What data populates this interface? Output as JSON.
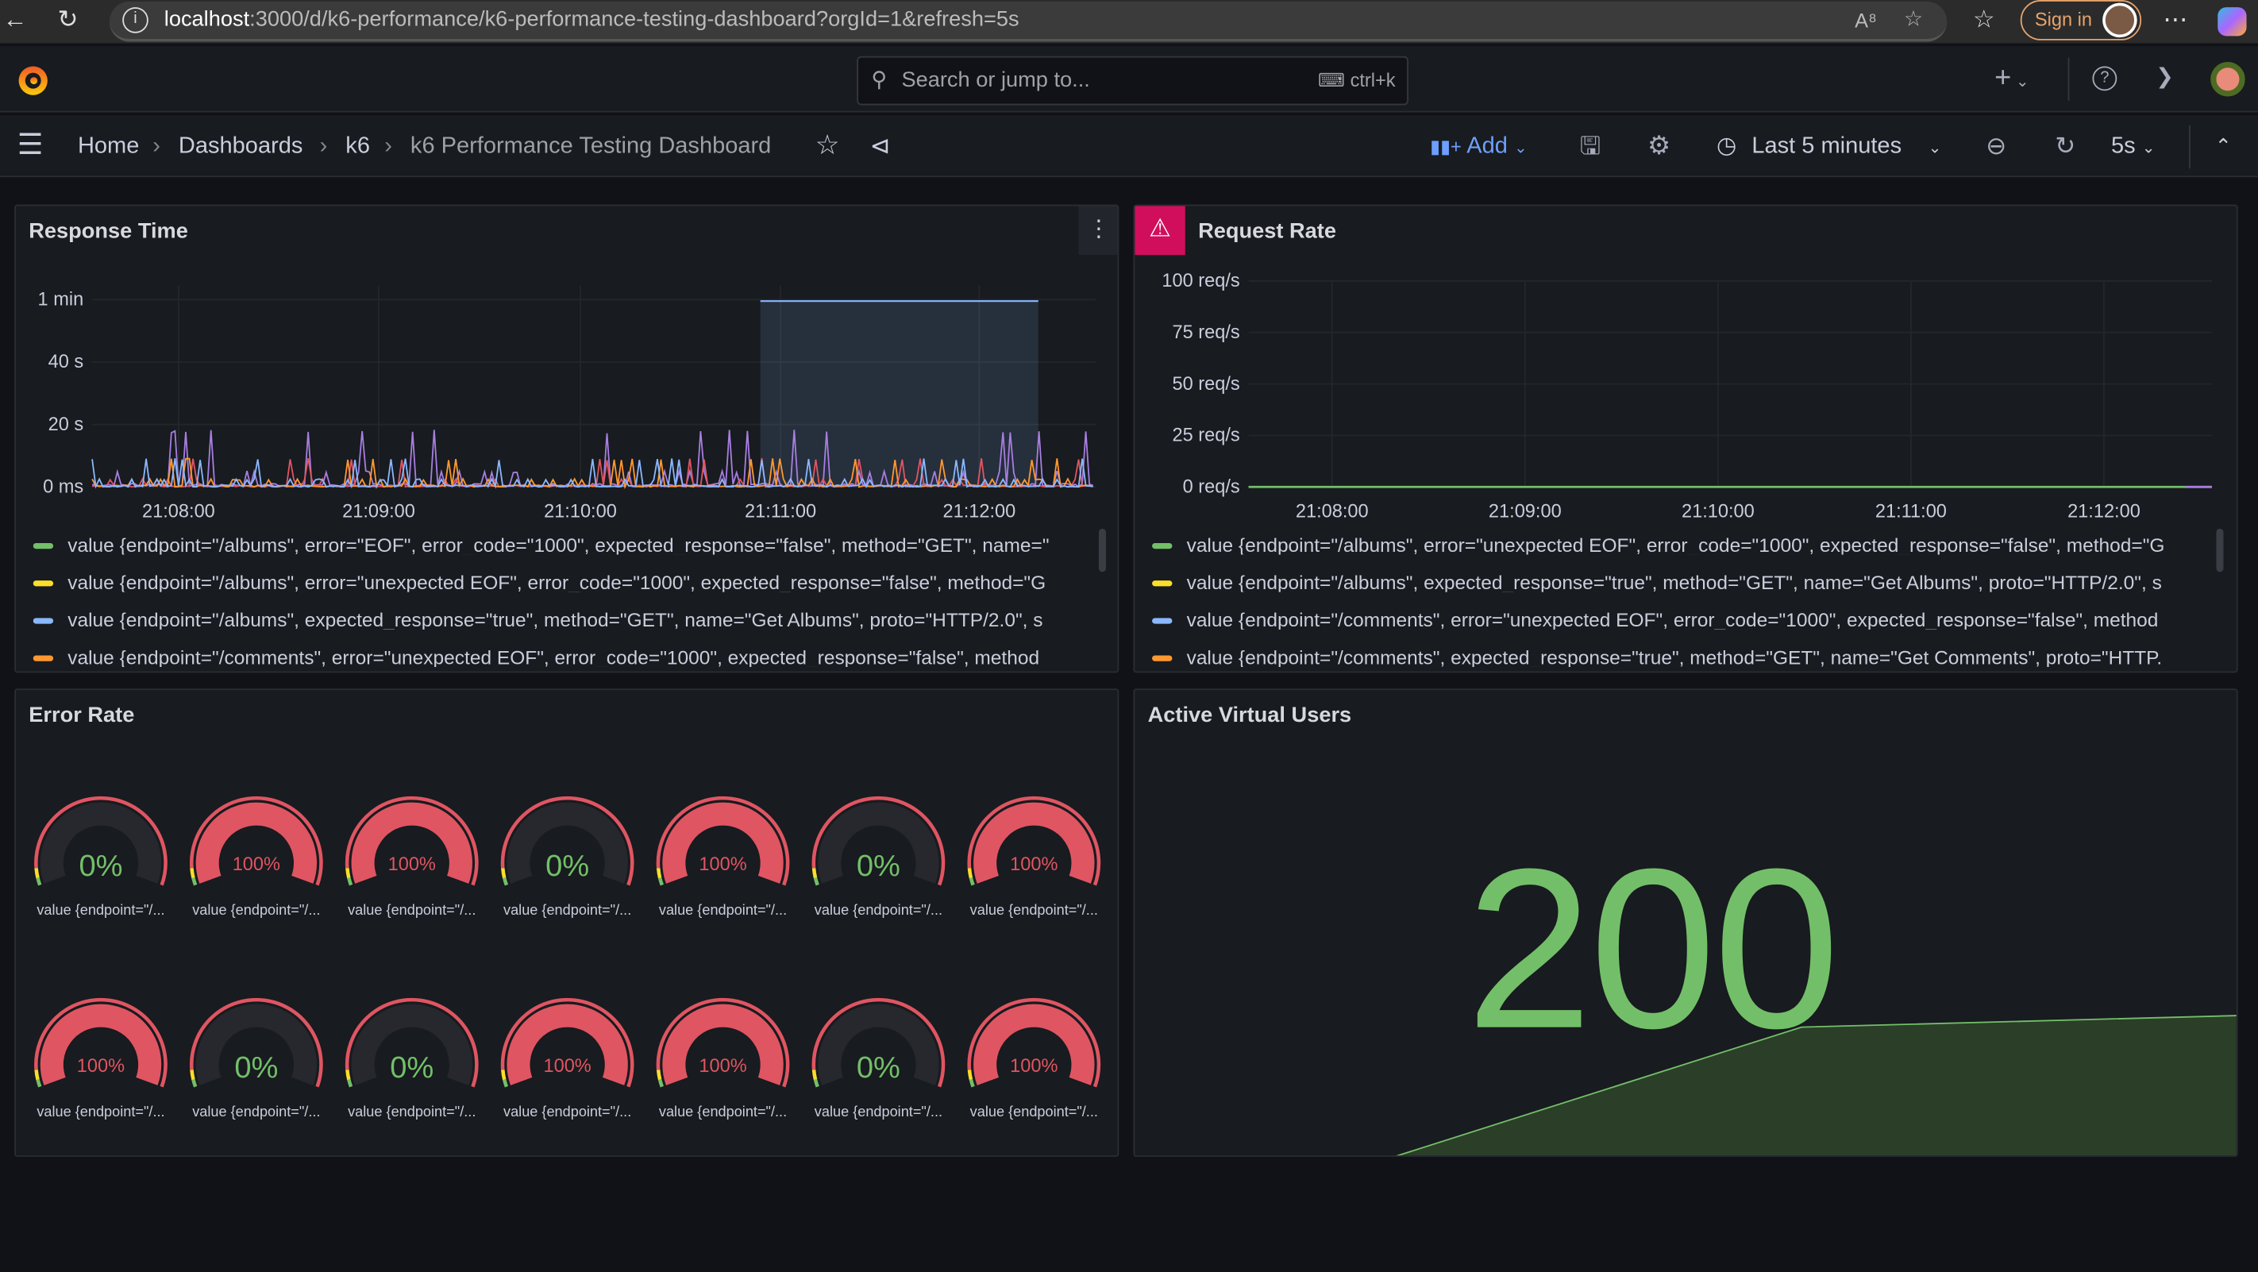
{
  "browser": {
    "url_host": "localhost",
    "url_rest": ":3000/d/k6-performance/k6-performance-testing-dashboard?orgId=1&refresh=5s",
    "sign_in": "Sign in"
  },
  "topnav": {
    "search_placeholder": "Search or jump to...",
    "shortcut": "ctrl+k"
  },
  "breadcrumb": {
    "items": [
      "Home",
      "Dashboards",
      "k6",
      "k6 Performance Testing Dashboard"
    ]
  },
  "toolbar": {
    "add": "Add",
    "time_range": "Last 5 minutes",
    "refresh_interval": "5s"
  },
  "panels": {
    "response_time": {
      "title": "Response Time",
      "legend": [
        {
          "color": "#73bf69",
          "text": "value {endpoint=\"/albums\", error=\"EOF\", error_code=\"1000\", expected_response=\"false\", method=\"GET\", name=\""
        },
        {
          "color": "#fade2a",
          "text": "value {endpoint=\"/albums\", error=\"unexpected EOF\", error_code=\"1000\", expected_response=\"false\", method=\"G"
        },
        {
          "color": "#8ab8ff",
          "text": "value {endpoint=\"/albums\", expected_response=\"true\", method=\"GET\", name=\"Get Albums\", proto=\"HTTP/2.0\", s"
        },
        {
          "color": "#ff9830",
          "text": "value {endpoint=\"/comments\", error=\"unexpected EOF\", error_code=\"1000\", expected_response=\"false\", method"
        }
      ]
    },
    "request_rate": {
      "title": "Request Rate",
      "legend": [
        {
          "color": "#73bf69",
          "text": "value {endpoint=\"/albums\", error=\"unexpected EOF\", error_code=\"1000\", expected_response=\"false\", method=\"G"
        },
        {
          "color": "#fade2a",
          "text": "value {endpoint=\"/albums\", expected_response=\"true\", method=\"GET\", name=\"Get Albums\", proto=\"HTTP/2.0\", s"
        },
        {
          "color": "#8ab8ff",
          "text": "value {endpoint=\"/comments\", error=\"unexpected EOF\", error_code=\"1000\", expected_response=\"false\", method"
        },
        {
          "color": "#ff9830",
          "text": "value {endpoint=\"/comments\", expected_response=\"true\", method=\"GET\", name=\"Get Comments\", proto=\"HTTP."
        }
      ]
    },
    "error_rate": {
      "title": "Error Rate",
      "gauge_label": "value {endpoint=\"/...",
      "values": [
        0,
        100,
        100,
        0,
        100,
        0,
        100,
        100,
        0,
        0,
        100,
        100,
        0,
        100
      ],
      "unit": "%"
    },
    "active_vus": {
      "title": "Active Virtual Users",
      "value": "200"
    }
  },
  "chart_data": [
    {
      "type": "line",
      "title": "Response Time",
      "yticks": [
        "0 ms",
        "20 s",
        "40 s",
        "1 min"
      ],
      "ylim": [
        0,
        60
      ],
      "xticks": [
        "21:08:00",
        "21:09:00",
        "21:10:00",
        "21:11:00",
        "21:12:00"
      ],
      "highlight": {
        "series": "value {endpoint=\"/albums\", expected_response=\"true\", ...}",
        "from": "21:11:00",
        "to": "21:12:20",
        "value_s": 60
      }
    },
    {
      "type": "line",
      "title": "Request Rate",
      "yticks": [
        "0 req/s",
        "25 req/s",
        "50 req/s",
        "75 req/s",
        "100 req/s"
      ],
      "ylim": [
        0,
        100
      ],
      "xticks": [
        "21:08:00",
        "21:09:00",
        "21:10:00",
        "21:11:00",
        "21:12:00"
      ],
      "values_req_s": 0
    },
    {
      "type": "area",
      "title": "Active Virtual Users",
      "value": 200
    }
  ],
  "colors": {
    "green": "#73bf69",
    "red": "#e05562",
    "yellow": "#fade2a",
    "accent": "#6e9fff"
  }
}
